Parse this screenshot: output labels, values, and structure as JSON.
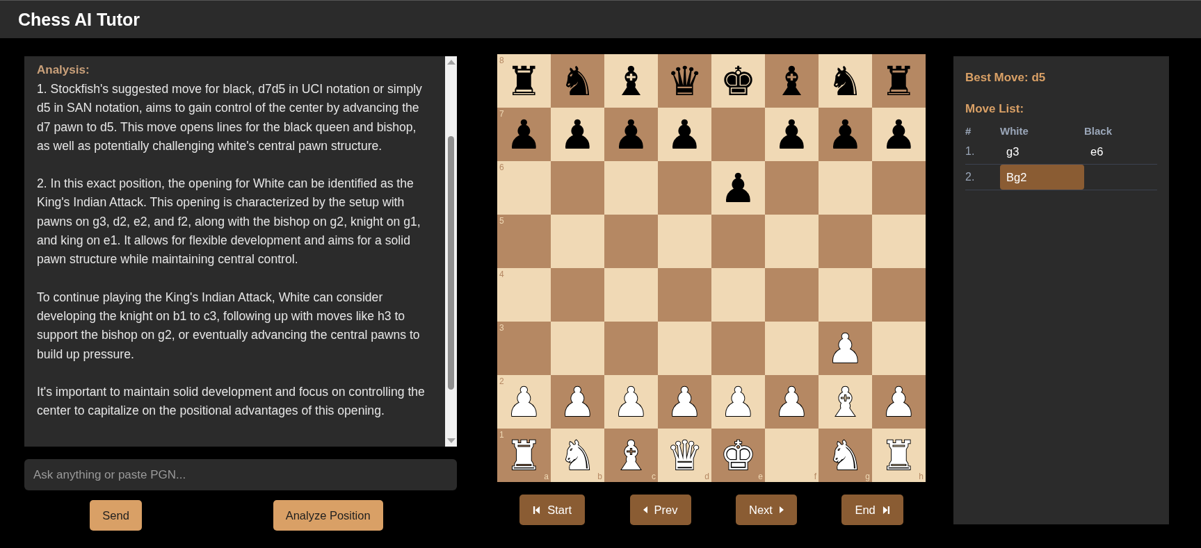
{
  "header": {
    "title": "Chess AI Tutor"
  },
  "analysis": {
    "heading": "Analysis:",
    "paragraphs": [
      "1. Stockfish's suggested move for black, d7d5 in UCI notation or simply d5 in SAN notation, aims to gain control of the center by advancing the d7 pawn to d5. This move opens lines for the black queen and bishop, as well as potentially challenging white's central pawn structure.",
      "2. In this exact position, the opening for White can be identified as the King's Indian Attack. This opening is characterized by the setup with pawns on g3, d2, e2, and f2, along with the bishop on g2, knight on g1, and king on e1. It allows for flexible development and aims for a solid pawn structure while maintaining central control.",
      "To continue playing the King's Indian Attack, White can consider developing the knight on b1 to c3, following up with moves like h3 to support the bishop on g2, or eventually advancing the central pawns to build up pressure.",
      "It's important to maintain solid development and focus on controlling the center to capitalize on the positional advantages of this opening."
    ]
  },
  "chat_input": {
    "placeholder": "Ask anything or paste PGN..."
  },
  "actions": [
    "Send",
    "Analyze Position"
  ],
  "board": {
    "rank_labels": [
      "8",
      "7",
      "6",
      "5",
      "4",
      "3",
      "2",
      "1"
    ],
    "file_labels": [
      "a",
      "b",
      "c",
      "d",
      "e",
      "f",
      "g",
      "h"
    ],
    "ranks": [
      [
        {
          "piece": "♜",
          "kind": "black"
        },
        {
          "piece": "♞",
          "kind": "black"
        },
        {
          "piece": "♝",
          "kind": "black"
        },
        {
          "piece": "♛",
          "kind": "black"
        },
        {
          "piece": "♚",
          "kind": "black"
        },
        {
          "piece": "♝",
          "kind": "black"
        },
        {
          "piece": "♞",
          "kind": "black"
        },
        {
          "piece": "♜",
          "kind": "black"
        }
      ],
      [
        {
          "piece": "♟",
          "kind": "black"
        },
        {
          "piece": "♟",
          "kind": "black"
        },
        {
          "piece": "♟",
          "kind": "black"
        },
        {
          "piece": "♟",
          "kind": "black"
        },
        {
          "kind": "empty"
        },
        {
          "piece": "♟",
          "kind": "black"
        },
        {
          "piece": "♟",
          "kind": "black"
        },
        {
          "piece": "♟",
          "kind": "black"
        }
      ],
      [
        {
          "kind": "empty"
        },
        {
          "kind": "empty"
        },
        {
          "kind": "empty"
        },
        {
          "kind": "empty"
        },
        {
          "piece": "♟",
          "kind": "black"
        },
        {
          "kind": "empty"
        },
        {
          "kind": "empty"
        },
        {
          "kind": "empty"
        }
      ],
      [
        {
          "kind": "empty"
        },
        {
          "kind": "empty"
        },
        {
          "kind": "empty"
        },
        {
          "kind": "empty"
        },
        {
          "kind": "empty"
        },
        {
          "kind": "empty"
        },
        {
          "kind": "empty"
        },
        {
          "kind": "empty"
        }
      ],
      [
        {
          "kind": "empty"
        },
        {
          "kind": "empty"
        },
        {
          "kind": "empty"
        },
        {
          "kind": "empty"
        },
        {
          "kind": "empty"
        },
        {
          "kind": "empty"
        },
        {
          "kind": "empty"
        },
        {
          "kind": "empty"
        }
      ],
      [
        {
          "kind": "empty"
        },
        {
          "kind": "empty"
        },
        {
          "kind": "empty"
        },
        {
          "kind": "empty"
        },
        {
          "kind": "empty"
        },
        {
          "kind": "empty"
        },
        {
          "piece": "♟",
          "kind": "white"
        },
        {
          "kind": "empty"
        }
      ],
      [
        {
          "piece": "♟",
          "kind": "white"
        },
        {
          "piece": "♟",
          "kind": "white"
        },
        {
          "piece": "♟",
          "kind": "white"
        },
        {
          "piece": "♟",
          "kind": "white"
        },
        {
          "piece": "♟",
          "kind": "white"
        },
        {
          "piece": "♟",
          "kind": "white"
        },
        {
          "piece": "♝",
          "kind": "white"
        },
        {
          "piece": "♟",
          "kind": "white"
        }
      ],
      [
        {
          "piece": "♜",
          "kind": "white"
        },
        {
          "piece": "♞",
          "kind": "white"
        },
        {
          "piece": "♝",
          "kind": "white"
        },
        {
          "piece": "♛",
          "kind": "white"
        },
        {
          "piece": "♚",
          "kind": "white"
        },
        {
          "kind": "empty"
        },
        {
          "piece": "♞",
          "kind": "white"
        },
        {
          "piece": "♜",
          "kind": "white"
        }
      ]
    ]
  },
  "navigation": [
    {
      "label": "Start",
      "kind": "first"
    },
    {
      "label": "Prev",
      "kind": "prev"
    },
    {
      "label": "Next",
      "kind": "next"
    },
    {
      "label": "End",
      "kind": "last"
    }
  ],
  "side_panel": {
    "best_move": "Best Move: d5",
    "move_list_title": "Move List:",
    "columns": [
      "#",
      "White",
      "Black"
    ],
    "moves": [
      {
        "number": "1.",
        "white": {
          "text": "g3",
          "selected": false
        },
        "black": {
          "text": "e6",
          "selected": false
        }
      },
      {
        "number": "2.",
        "white": {
          "text": "Bg2",
          "selected": true
        }
      }
    ]
  }
}
